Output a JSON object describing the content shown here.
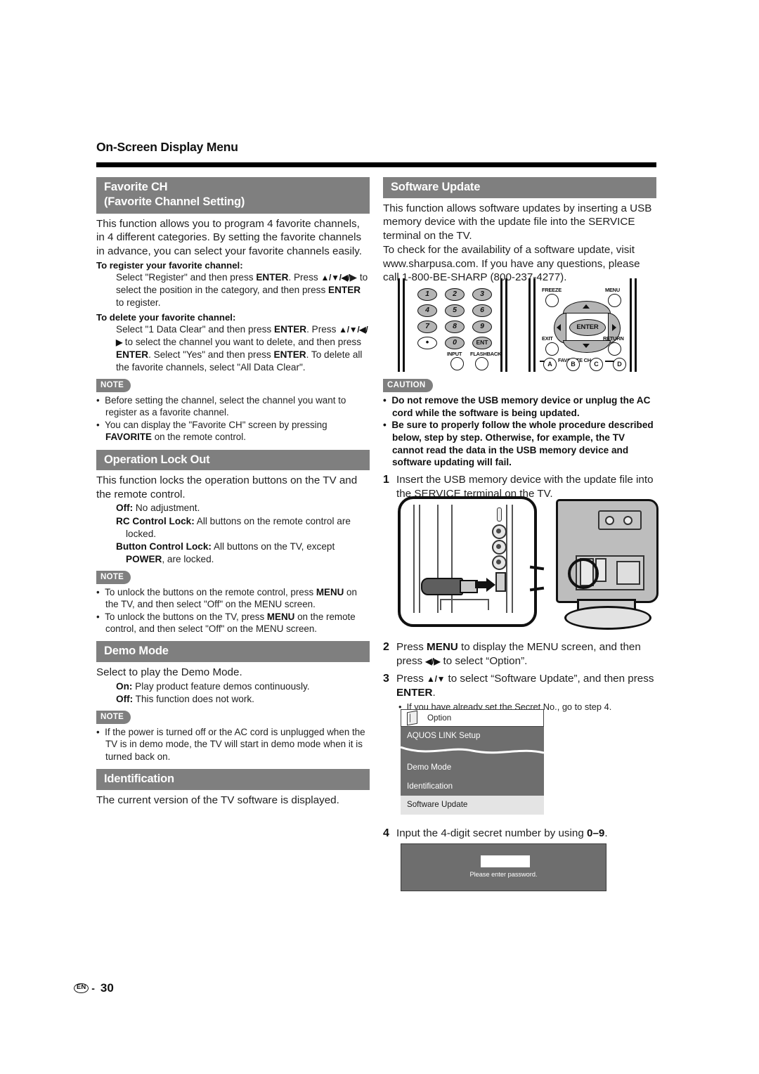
{
  "header": {
    "title": "On-Screen Display Menu"
  },
  "left_column": {
    "favorite_ch": {
      "heading_line1": "Favorite CH",
      "heading_line2": "(Favorite Channel Setting)",
      "intro": "This function allows you to program 4 favorite channels, in 4 different categories. By setting the favorite channels in advance, you can select your favorite channels easily.",
      "register_label": "To register your favorite channel:",
      "register_text_1": "Select \"Register\" and then press ",
      "register_enter_1": "ENTER",
      "register_text_2": ". Press ",
      "register_arrows_1": "▲/▼/◀/",
      "register_text_3": "▶ to select the position in the category, and then press ",
      "register_enter_2": "ENTER",
      "register_text_4": " to register.",
      "delete_label": "To delete your favorite channel:",
      "delete_text_1": "Select \"1 Data Clear\" and then press ",
      "delete_enter_1": "ENTER",
      "delete_text_2": ". Press ",
      "delete_arrows": "▲/▼/◀/▶",
      "delete_text_3": " to select the channel you want to delete, and then press ",
      "delete_enter_2": "ENTER",
      "delete_text_4": ". Select \"Yes\" and then press ",
      "delete_enter_3": "ENTER",
      "delete_text_5": ". To delete all the favorite channels, select \"All Data Clear\".",
      "note_badge": "NOTE",
      "note_1": "Before setting the channel, select the channel you want to register as a favorite channel.",
      "note_2_a": "You can display the \"Favorite CH\" screen by pressing ",
      "note_2_bold": "FAVORITE",
      "note_2_b": " on the remote control."
    },
    "operation_lock_out": {
      "heading": "Operation Lock Out",
      "intro": "This function locks the operation buttons on the TV and the remote control.",
      "opt_off_label": "Off:",
      "opt_off_text": " No adjustment.",
      "opt_rc_label": "RC Control Lock:",
      "opt_rc_text": " All buttons on the remote control are locked.",
      "opt_btn_label": "Button Control Lock:",
      "opt_btn_text_a": " All buttons on the TV, except ",
      "opt_btn_bold": "POWER",
      "opt_btn_text_b": ", are locked.",
      "note_badge": "NOTE",
      "note_1_a": "To unlock the buttons on the remote control, press ",
      "note_1_bold": "MENU",
      "note_1_b": " on the TV, and then select \"Off\" on the MENU screen.",
      "note_2_a": "To unlock the buttons on the TV, press ",
      "note_2_bold": "MENU",
      "note_2_b": " on the remote control, and then select \"Off\" on the MENU screen."
    },
    "demo_mode": {
      "heading": "Demo Mode",
      "intro": "Select to play the Demo Mode.",
      "opt_on_label": "On:",
      "opt_on_text": " Play product feature demos continuously.",
      "opt_off_label": "Off:",
      "opt_off_text": " This function does not work.",
      "note_badge": "NOTE",
      "note_1": "If the power is turned off or the AC cord is unplugged when the TV is in demo mode, the TV will start in demo mode when it is turned back on."
    },
    "identification": {
      "heading": "Identification",
      "text": "The current version of the TV software is displayed."
    }
  },
  "right_column": {
    "software_update": {
      "heading": "Software Update",
      "para_1": "This function allows software updates by inserting a USB memory device with the update file into the SERVICE terminal on the TV.",
      "para_2": "To check for the availability of a software update, visit www.sharpusa.com. If you have any questions, please call 1-800-BE-SHARP (800-237-4277)."
    },
    "remote_figure": {
      "keys_numeric": [
        "1",
        "2",
        "3",
        "4",
        "5",
        "6",
        "7",
        "8",
        "9",
        "•",
        "0",
        "ENT"
      ],
      "label_input": "INPUT",
      "label_flashback": "FLASHBACK",
      "label_freeze": "FREEZE",
      "label_menu": "MENU",
      "label_exit": "EXIT",
      "label_return": "RETURN",
      "label_enter": "ENTER",
      "label_favorite_ch": "FAVORITE CH",
      "keys_abcd": [
        "A",
        "B",
        "C",
        "D"
      ]
    },
    "caution": {
      "badge": "CAUTION",
      "item_1": "Do not remove the USB memory device or unplug the AC cord while the software is being updated.",
      "item_2": "Be sure to properly follow the whole procedure described below, step by step. Otherwise, for example, the TV cannot read the data in the USB memory device and software updating will fail."
    },
    "steps": [
      {
        "num": "1",
        "text": "Insert the USB memory device with the update file into the SERVICE terminal on the TV."
      },
      {
        "num": "2",
        "text_a": "Press ",
        "bold_1": "MENU",
        "text_b": " to display the MENU screen, and then press ",
        "arrows": "◀/▶",
        "text_c": " to select “Option”."
      },
      {
        "num": "3",
        "text_a": "Press ",
        "arrows": "▲/▼",
        "text_b": " to select “Software Update”, and then press ",
        "bold_1": "ENTER",
        "text_c": ".",
        "subnote": "If you have already set the Secret No., go to step 4."
      },
      {
        "num": "4",
        "text_a": "Input the 4-digit secret number by using ",
        "bold_1": "0–9",
        "text_b": "."
      }
    ],
    "osd_menu": {
      "top_label": "Option",
      "rows": [
        "AQUOS LINK Setup",
        "Demo Mode",
        "Identification",
        "Software Update"
      ],
      "selected": "Software Update"
    },
    "password_dialog": {
      "prompt": "Please enter password.",
      "field_value": ""
    }
  },
  "footer": {
    "lang_badge": "EN",
    "dash": "-",
    "page_number": "30"
  },
  "colors": {
    "section_bar": "#7f7f7f",
    "osd_background": "#6e6e6e",
    "osd_selected": "#e4e4e4",
    "rule": "#000000"
  }
}
